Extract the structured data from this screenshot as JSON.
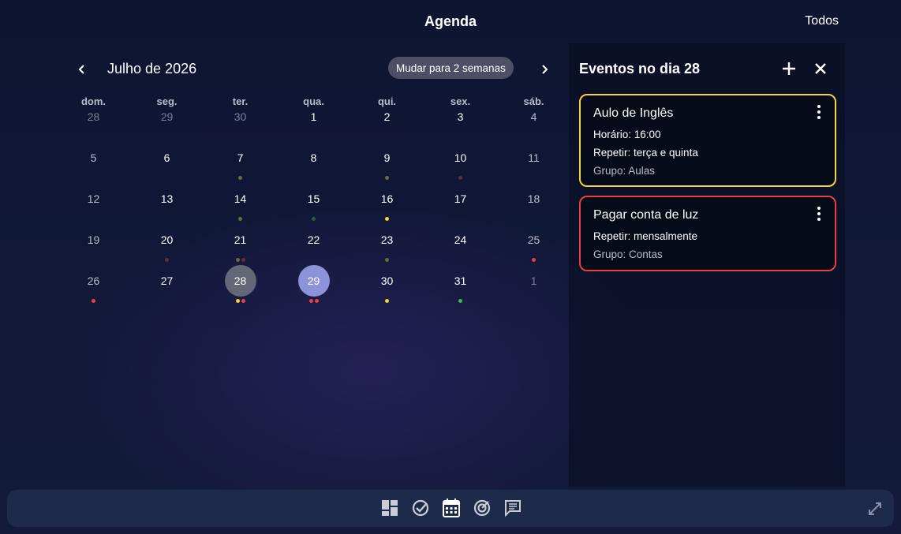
{
  "header": {
    "title": "Agenda",
    "todos": "Todos"
  },
  "calendar": {
    "month_label": "Julho de 2026",
    "switch_label": "Mudar para 2 semanas",
    "weekdays": [
      "dom.",
      "seg.",
      "ter.",
      "qua.",
      "qui.",
      "sex.",
      "sáb."
    ],
    "weeks": [
      [
        {
          "d": "28",
          "dim": true
        },
        {
          "d": "29",
          "dim": true
        },
        {
          "d": "30",
          "dim": true
        },
        {
          "d": "1"
        },
        {
          "d": "2"
        },
        {
          "d": "3"
        },
        {
          "d": "4",
          "w": true
        }
      ],
      [
        {
          "d": "5",
          "w": true
        },
        {
          "d": "6"
        },
        {
          "d": "7",
          "dots": [
            "#6b6a3a"
          ]
        },
        {
          "d": "8"
        },
        {
          "d": "9",
          "dots": [
            "#6b6a3a"
          ]
        },
        {
          "d": "10",
          "dots": [
            "#6a2a34"
          ]
        },
        {
          "d": "11",
          "w": true
        }
      ],
      [
        {
          "d": "12",
          "w": true
        },
        {
          "d": "13"
        },
        {
          "d": "14",
          "dots": [
            "#6b6a3a"
          ]
        },
        {
          "d": "15",
          "dots": [
            "#2f5a3a"
          ]
        },
        {
          "d": "16",
          "dots": [
            "#f5d33a"
          ]
        },
        {
          "d": "17"
        },
        {
          "d": "18",
          "w": true
        }
      ],
      [
        {
          "d": "19",
          "w": true
        },
        {
          "d": "20",
          "dots": [
            "#6a2a34"
          ]
        },
        {
          "d": "21",
          "dots": [
            "#6b6a3a",
            "#6a2a34"
          ]
        },
        {
          "d": "22"
        },
        {
          "d": "23",
          "dots": [
            "#6b6a3a"
          ]
        },
        {
          "d": "24"
        },
        {
          "d": "25",
          "w": true,
          "dots": [
            "#e84040"
          ]
        }
      ],
      [
        {
          "d": "26",
          "w": true,
          "dots": [
            "#e84040"
          ]
        },
        {
          "d": "27"
        },
        {
          "d": "28",
          "sel": true,
          "dots": [
            "#f5d33a",
            "#e84040"
          ]
        },
        {
          "d": "29",
          "today": true,
          "dots": [
            "#e84040",
            "#e84040"
          ]
        },
        {
          "d": "30",
          "dots": [
            "#f5d33a"
          ]
        },
        {
          "d": "31",
          "dots": [
            "#3aba4a"
          ]
        },
        {
          "d": "1",
          "dim": true
        }
      ]
    ]
  },
  "panel": {
    "title": "Eventos no dia 28",
    "events": [
      {
        "title": "Aulo de Inglês",
        "lines": [
          "Horário: 16:00",
          "Repetir: terça e quinta"
        ],
        "group": "Grupo: Aulas",
        "color": "#f5d33a"
      },
      {
        "title": "Pagar conta de luz",
        "lines": [
          "Repetir: mensalmente"
        ],
        "group": "Grupo: Contas",
        "color": "#e84040"
      }
    ]
  },
  "bottombar": {
    "icons": [
      "dashboard-icon",
      "check-circle-icon",
      "calendar-icon",
      "target-icon",
      "chat-icon"
    ],
    "expand": "expand-icon"
  }
}
